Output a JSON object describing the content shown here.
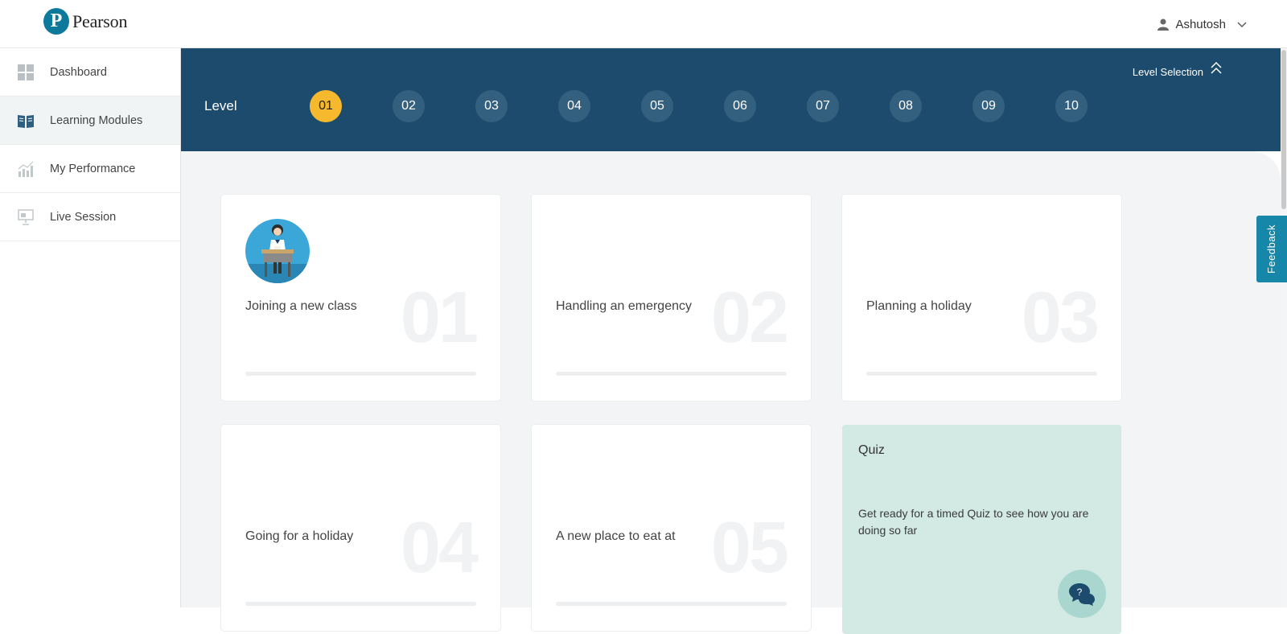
{
  "header": {
    "logo_mark": "P",
    "logo_text": "Pearson",
    "user_name": "Ashutosh"
  },
  "sidebar": {
    "items": [
      {
        "label": "Dashboard",
        "icon": "grid-icon"
      },
      {
        "label": "Learning Modules",
        "icon": "book-icon",
        "active": true
      },
      {
        "label": "My Performance",
        "icon": "bar-chart-icon"
      },
      {
        "label": "Live Session",
        "icon": "presentation-icon"
      }
    ]
  },
  "levels": {
    "title": "Level",
    "selection_label": "Level Selection",
    "items": [
      "01",
      "02",
      "03",
      "04",
      "05",
      "06",
      "07",
      "08",
      "09",
      "10"
    ],
    "active": "01"
  },
  "modules": [
    {
      "title": "Joining a new class",
      "number": "01",
      "progress": 0
    },
    {
      "title": "Handling an emergency",
      "number": "02",
      "progress": 0
    },
    {
      "title": "Planning a holiday",
      "number": "03",
      "progress": 0
    },
    {
      "title": "Going for a holiday",
      "number": "04",
      "progress": 0
    },
    {
      "title": "A new place to eat at",
      "number": "05",
      "progress": 0
    }
  ],
  "quiz": {
    "title": "Quiz",
    "description": "Get ready for a timed Quiz to see how you are doing so far"
  },
  "feedback_label": "Feedback",
  "colors": {
    "primary": "#1c4b6d",
    "accent": "#f6b82c",
    "quiz_bg": "#d3eae4",
    "feedback": "#1687a8"
  }
}
